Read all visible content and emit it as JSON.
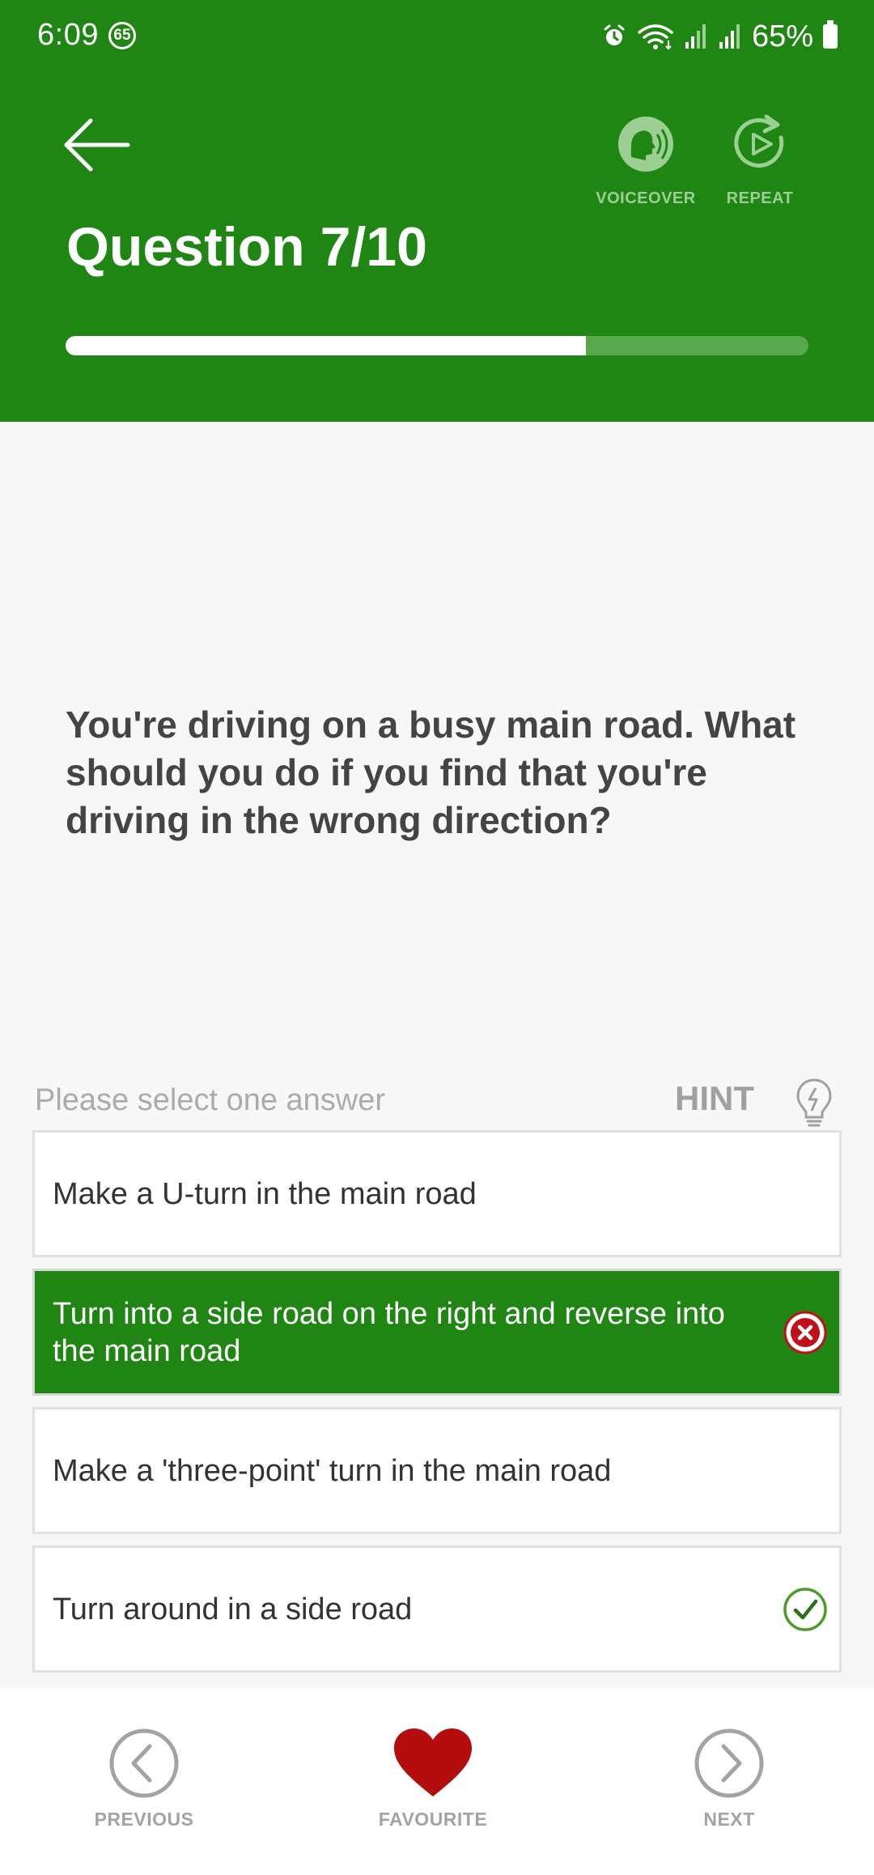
{
  "status": {
    "time": "6:09",
    "badge": "65",
    "battery": "65%"
  },
  "header": {
    "back_icon": "arrow-left-icon",
    "voiceover_label": "VOICEOVER",
    "repeat_label": "REPEAT",
    "title": "Question 7/10",
    "progress": 0.7
  },
  "question": {
    "text": "You're driving on a busy main road. What should you do if you find that you're driving in the wrong direction?"
  },
  "answers_header": {
    "prompt": "Please select one answer",
    "hint_label": "HINT"
  },
  "answers": [
    {
      "text": "Make a U-turn in the main road",
      "state": "none"
    },
    {
      "text": "Turn into a side road on the right and reverse into the main road",
      "state": "selected-wrong"
    },
    {
      "text": "Make a 'three-point' turn in the main road",
      "state": "none"
    },
    {
      "text": "Turn around in a side road",
      "state": "correct"
    }
  ],
  "bottom_nav": {
    "previous_label": "PREVIOUS",
    "favourite_label": "FAVOURITE",
    "next_label": "NEXT"
  },
  "colors": {
    "brand_green": "#1f8613",
    "favourite_red": "#b30d0d",
    "wrong_red": "#c0101a",
    "correct_green": "#4a9a2c"
  }
}
